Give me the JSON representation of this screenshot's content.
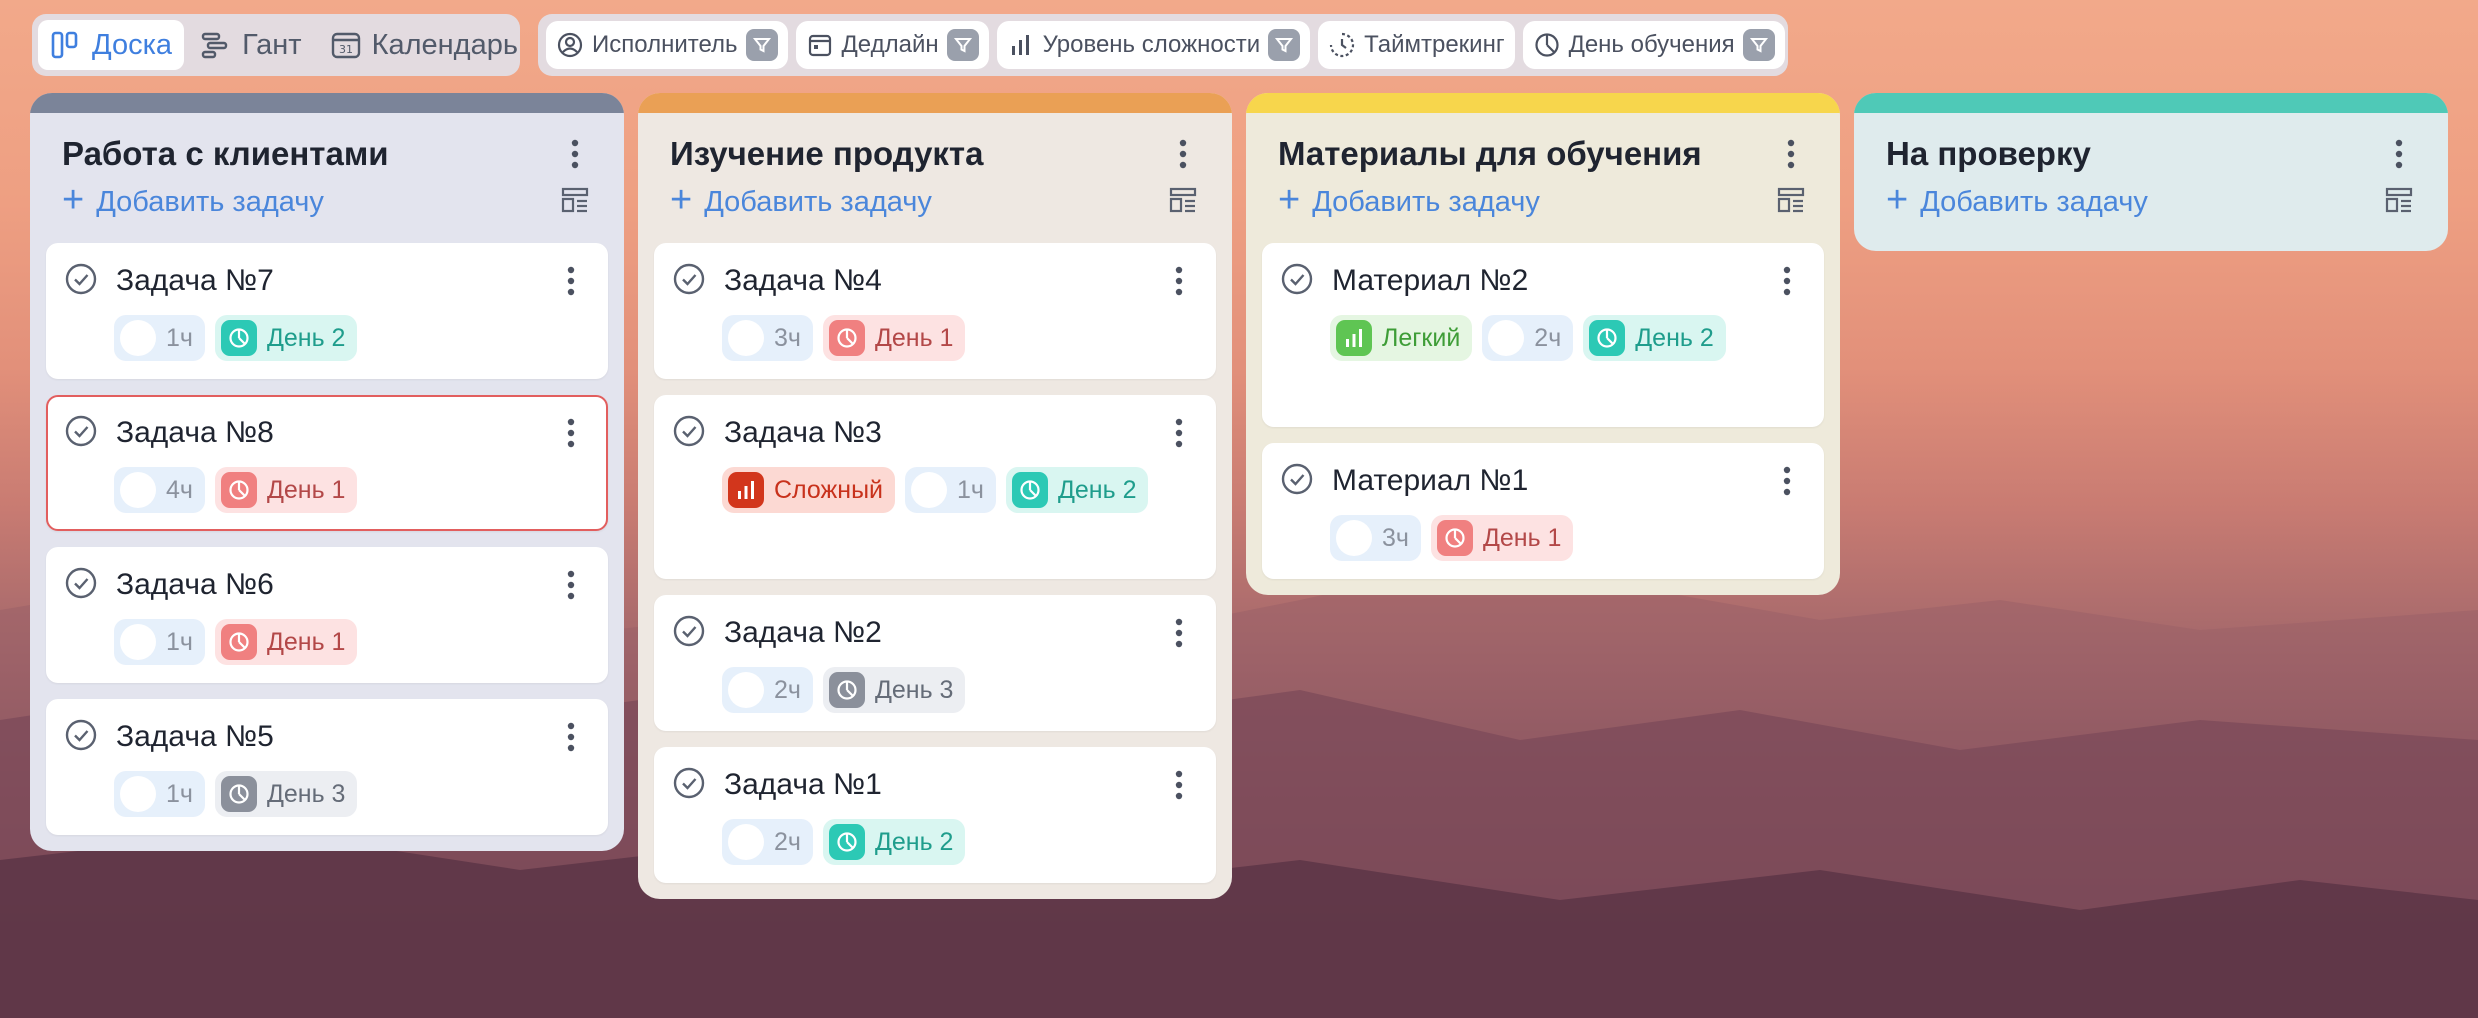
{
  "toolbar": {
    "views": [
      {
        "label": "Доска",
        "icon": "board-icon",
        "active": true
      },
      {
        "label": "Гант",
        "icon": "gantt-icon",
        "active": false
      },
      {
        "label": "Календарь",
        "icon": "calendar-icon",
        "active": false
      }
    ],
    "filters": [
      {
        "label": "Исполнитель",
        "icon": "user-icon",
        "has_filter": true
      },
      {
        "label": "Дедлайн",
        "icon": "calendar-icon",
        "has_filter": true
      },
      {
        "label": "Уровень сложности",
        "icon": "bars-icon",
        "has_filter": true
      },
      {
        "label": "Таймтрекинг",
        "icon": "timer-icon",
        "has_filter": false
      },
      {
        "label": "День обучения",
        "icon": "pie-icon",
        "has_filter": true
      }
    ]
  },
  "columns": [
    {
      "title": "Работа с клиентами",
      "add_label": "Добавить задачу",
      "stripe_color": "#7b8499",
      "bg_color": "#e3e4ee",
      "cards": [
        {
          "title": "Задача №7",
          "time": "1ч",
          "day": "День 2",
          "day_kind": "d2"
        },
        {
          "title": "Задача №8",
          "time": "4ч",
          "day": "День 1",
          "day_kind": "d1",
          "selected": true
        },
        {
          "title": "Задача №6",
          "time": "1ч",
          "day": "День 1",
          "day_kind": "d1"
        },
        {
          "title": "Задача №5",
          "time": "1ч",
          "day": "День 3",
          "day_kind": "d3"
        }
      ]
    },
    {
      "title": "Изучение продукта",
      "add_label": "Добавить задачу",
      "stripe_color": "#eaa055",
      "bg_color": "#eee8e2",
      "cards": [
        {
          "title": "Задача №4",
          "time": "3ч",
          "day": "День 1",
          "day_kind": "d1"
        },
        {
          "title": "Задача №3",
          "difficulty": "Сложный",
          "difficulty_kind": "hard",
          "time": "1ч",
          "day": "День 2",
          "day_kind": "d2"
        },
        {
          "title": "Задача №2",
          "time": "2ч",
          "day": "День 3",
          "day_kind": "d3"
        },
        {
          "title": "Задача №1",
          "time": "2ч",
          "day": "День 2",
          "day_kind": "d2"
        }
      ]
    },
    {
      "title": "Материалы для обучения",
      "add_label": "Добавить задачу",
      "stripe_color": "#f7d64c",
      "bg_color": "#eeeadb",
      "cards": [
        {
          "title": "Материал №2",
          "difficulty": "Легкий",
          "difficulty_kind": "easy",
          "time": "2ч",
          "day": "День 2",
          "day_kind": "d2"
        },
        {
          "title": "Материал №1",
          "time": "3ч",
          "day": "День 1",
          "day_kind": "d1"
        }
      ]
    },
    {
      "title": "На проверку",
      "add_label": "Добавить задачу",
      "stripe_color": "#4fc9b7",
      "bg_color": "#dfebed",
      "cards": []
    }
  ]
}
